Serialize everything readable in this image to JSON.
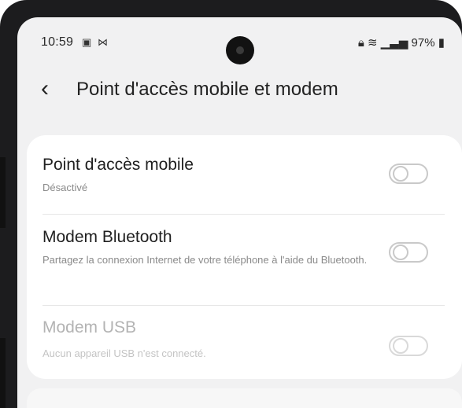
{
  "status_bar": {
    "time": "10:59",
    "left_icons": [
      "image-icon",
      "nfc-icon"
    ],
    "right_icons": [
      "lock-icon",
      "wifi-icon",
      "signal-icon",
      "battery-icon"
    ],
    "battery": "97%"
  },
  "header": {
    "back_icon": "chevron-left-icon",
    "title": "Point d'accès mobile et modem"
  },
  "settings": [
    {
      "title": "Point d'accès mobile",
      "subtitle": "Désactivé",
      "enabled": true,
      "on": false
    },
    {
      "title": "Modem Bluetooth",
      "subtitle": "Partagez la connexion Internet de votre téléphone à l'aide du Bluetooth.",
      "enabled": true,
      "on": false
    },
    {
      "title": "Modem USB",
      "subtitle": "Aucun appareil USB n'est connecté.",
      "enabled": false,
      "on": false
    }
  ],
  "colors": {
    "screen_bg": "#f1f1f2",
    "card_bg": "#ffffff",
    "text_primary": "#202020",
    "text_secondary": "#8a8a8a",
    "text_disabled": "#b3b3b3"
  }
}
